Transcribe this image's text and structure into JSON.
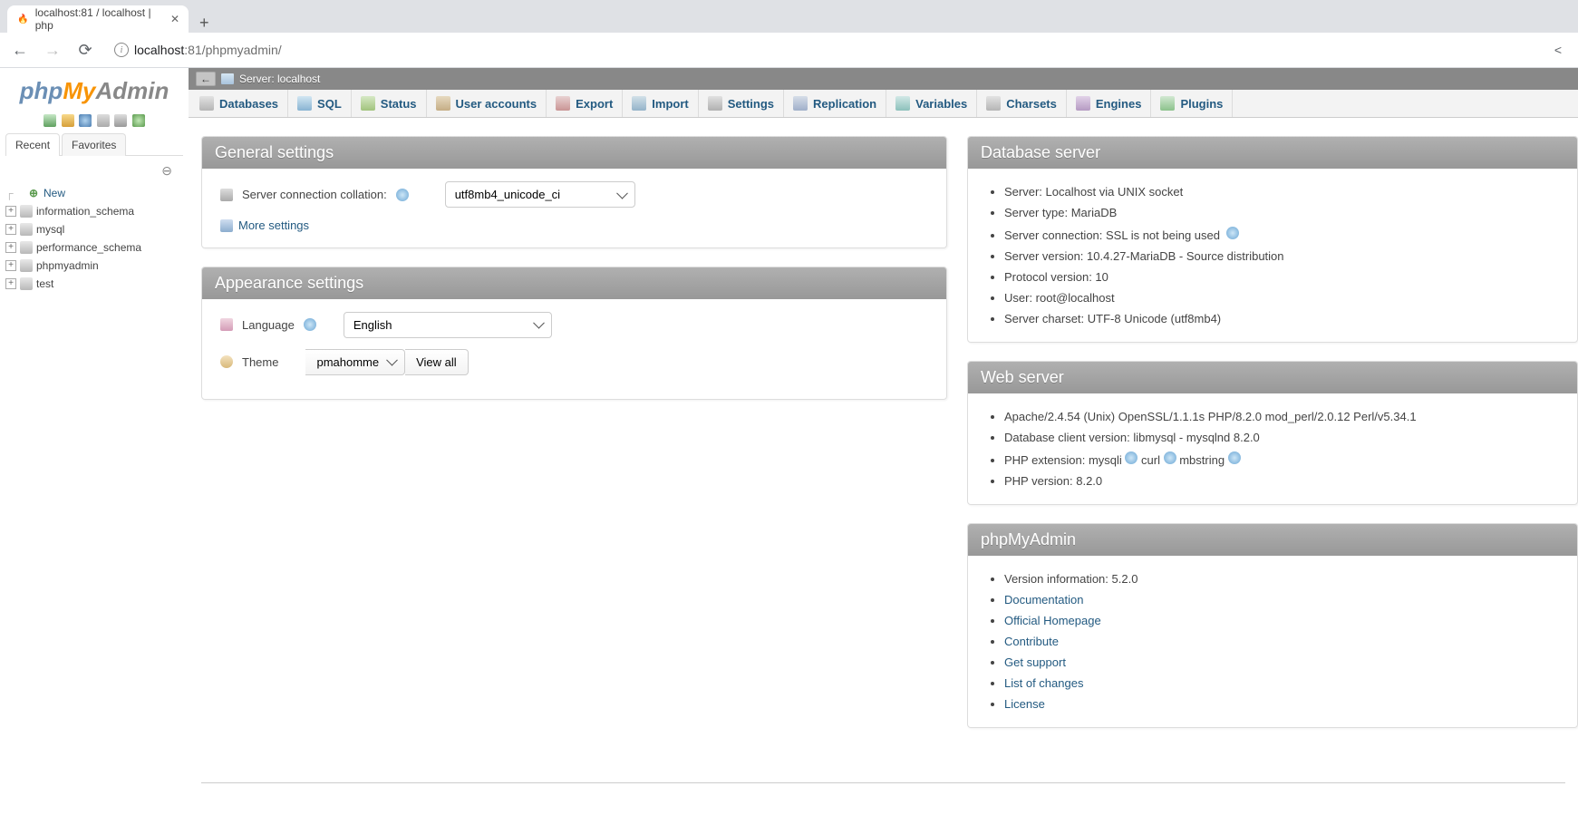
{
  "browser": {
    "tab_title": "localhost:81 / localhost | php",
    "url_host": "localhost",
    "url_port": ":81",
    "url_path": "/phpmyadmin/"
  },
  "sidebar": {
    "logo": {
      "php": "php",
      "my": "My",
      "admin": "Admin"
    },
    "tabs": {
      "recent": "Recent",
      "favorites": "Favorites"
    },
    "new_label": "New",
    "databases": [
      {
        "name": "information_schema"
      },
      {
        "name": "mysql"
      },
      {
        "name": "performance_schema"
      },
      {
        "name": "phpmyadmin"
      },
      {
        "name": "test"
      }
    ]
  },
  "serverinfo": {
    "back": "←",
    "label": "Server: localhost"
  },
  "topmenu": [
    {
      "label": "Databases",
      "icon": "mi-db",
      "name": "databases"
    },
    {
      "label": "SQL",
      "icon": "mi-sql",
      "name": "sql"
    },
    {
      "label": "Status",
      "icon": "mi-status",
      "name": "status"
    },
    {
      "label": "User accounts",
      "icon": "mi-users",
      "name": "user-accounts"
    },
    {
      "label": "Export",
      "icon": "mi-export",
      "name": "export"
    },
    {
      "label": "Import",
      "icon": "mi-import",
      "name": "import"
    },
    {
      "label": "Settings",
      "icon": "mi-settings",
      "name": "settings"
    },
    {
      "label": "Replication",
      "icon": "mi-replication",
      "name": "replication"
    },
    {
      "label": "Variables",
      "icon": "mi-variables",
      "name": "variables"
    },
    {
      "label": "Charsets",
      "icon": "mi-charsets",
      "name": "charsets"
    },
    {
      "label": "Engines",
      "icon": "mi-engines",
      "name": "engines"
    },
    {
      "label": "Plugins",
      "icon": "mi-plugins",
      "name": "plugins"
    }
  ],
  "panels": {
    "general": {
      "title": "General settings",
      "collation_label": "Server connection collation:",
      "collation_value": "utf8mb4_unicode_ci",
      "more_settings": "More settings"
    },
    "appearance": {
      "title": "Appearance settings",
      "language_label": "Language",
      "language_value": "English",
      "theme_label": "Theme",
      "theme_value": "pmahomme",
      "view_all": "View all"
    },
    "dbserver": {
      "title": "Database server",
      "items": [
        "Server: Localhost via UNIX socket",
        "Server type: MariaDB",
        "Server connection: SSL is not being used",
        "Server version: 10.4.27-MariaDB - Source distribution",
        "Protocol version: 10",
        "User: root@localhost",
        "Server charset: UTF-8 Unicode (utf8mb4)"
      ]
    },
    "webserver": {
      "title": "Web server",
      "items": [
        "Apache/2.4.54 (Unix) OpenSSL/1.1.1s PHP/8.2.0 mod_perl/2.0.12 Perl/v5.34.1",
        "Database client version: libmysql - mysqlnd 8.2.0",
        "PHP extension: mysqli   curl   mbstring",
        "PHP version: 8.2.0"
      ]
    },
    "pma": {
      "title": "phpMyAdmin",
      "version_label": "Version information: 5.2.0",
      "links": [
        "Documentation",
        "Official Homepage",
        "Contribute",
        "Get support",
        "List of changes",
        "License"
      ]
    }
  }
}
